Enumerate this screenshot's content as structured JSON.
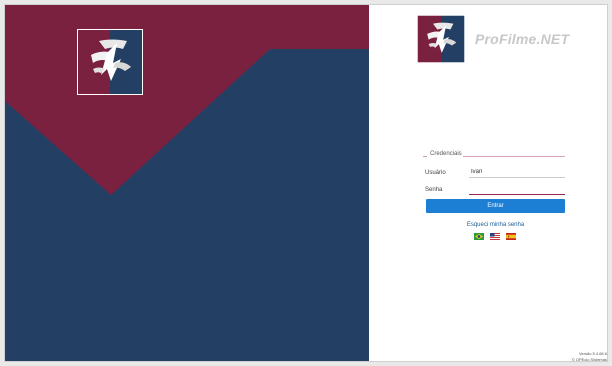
{
  "brand": {
    "name": "ProFilme.NET",
    "logo_icon": "profilme-mask-logo-icon",
    "colors": {
      "maroon": "#7a2140",
      "navy": "#243f64",
      "accent_button": "#1d7fd3",
      "link": "#1a5f99"
    }
  },
  "login": {
    "legend": "Credenciais",
    "username_label": "Usuário",
    "username_value": "Ivan",
    "password_label": "Senha",
    "password_value": "",
    "submit_label": "Entrar",
    "forgot_password": "Esqueci minha senha"
  },
  "languages": [
    {
      "name": "brazil-flag-icon"
    },
    {
      "name": "usa-flag-icon"
    },
    {
      "name": "spain-flag-icon"
    }
  ],
  "footer": {
    "version": "Versão 5.4.68.6",
    "copyright": "© OPEcio Sistemas"
  }
}
